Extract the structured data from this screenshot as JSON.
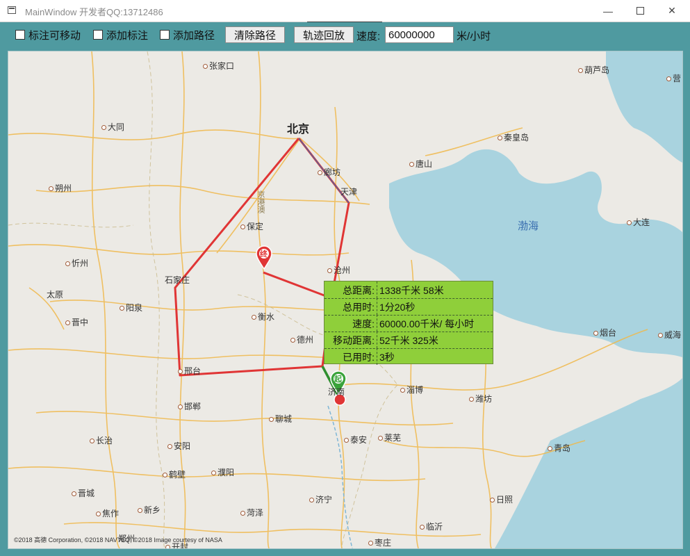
{
  "window": {
    "title": "MainWindow 开发者QQ:13712486"
  },
  "toolbar": {
    "check_movable": "标注可移动",
    "check_add_marker": "添加标注",
    "check_add_path": "添加路径",
    "clear_path": "清除路径",
    "replay": "轨迹回放",
    "speed_label": "速度:",
    "speed_value": "60000000",
    "speed_unit": "米/小时"
  },
  "map": {
    "cities": {
      "beijing": "北京",
      "tianjin": "天津",
      "langfang": "廊坊",
      "baoding": "保定",
      "shijiazhuang": "石家庄",
      "taiyuan": "太原",
      "datong": "大同",
      "zhangjiakou": "张家口",
      "shuozhou": "朔州",
      "xinzhou": "忻州",
      "yangquan": "阳泉",
      "jinzhong": "晋中",
      "xingtai": "邢台",
      "handan": "邯郸",
      "changzhi": "长治",
      "anyang": "安阳",
      "hebi": "鹤壁",
      "puyang": "濮阳",
      "jincheng": "晋城",
      "jiaozuo": "焦作",
      "xinxiang": "新乡",
      "hengshui": "衡水",
      "cangzhou": "沧州",
      "dezhou": "德州",
      "liaocheng": "聊城",
      "jinan": "济南",
      "taian": "泰安",
      "laiwu": "莱芜",
      "zibo": "淄博",
      "weifang": "潍坊",
      "qingdao": "青岛",
      "rizhao": "日照",
      "linyi": "临沂",
      "jining": "济宁",
      "heze": "菏泽",
      "zaozhuang": "枣庄",
      "yantai": "烟台",
      "weihai": "威海",
      "dalian": "大连",
      "qinhuangdao": "秦皇岛",
      "tangshan": "唐山",
      "huludao": "葫芦岛",
      "yingkou": "营",
      "zhengzhou": "郑州",
      "kaifeng": "开封"
    },
    "sea": "渤海",
    "marker_start": "起",
    "marker_end": "终",
    "highway_label": "京港澳",
    "copyright": "©2018 高德 Corporation, ©2018 NAVTEQ, ©2018 Image courtesy of NASA",
    "route_color": "#e03535",
    "replay_color": "#2f8f2f"
  },
  "info": {
    "rows": [
      {
        "key": "总距离:",
        "value": "1338千米 58米"
      },
      {
        "key": "总用时:",
        "value": "1分20秒"
      },
      {
        "key": "速度:",
        "value": "60000.00千米/ 每小时"
      },
      {
        "key": "移动距离:",
        "value": "52千米 325米"
      },
      {
        "key": "已用时:",
        "value": "3秒"
      }
    ]
  }
}
